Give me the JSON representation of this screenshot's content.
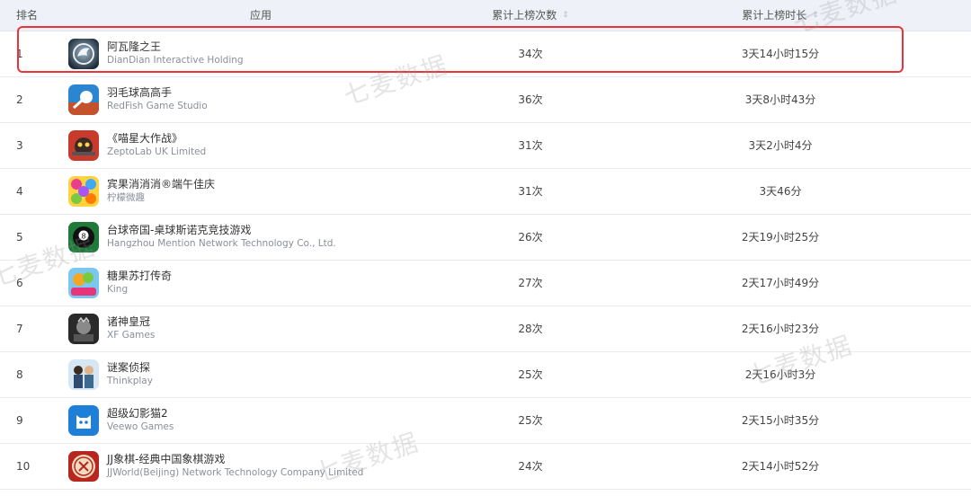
{
  "header": {
    "rank": "排名",
    "app": "应用",
    "count": "累计上榜次数",
    "duration": "累计上榜时长"
  },
  "sort_glyph": "⇕",
  "watermark": "七麦数据",
  "highlight_color": "#e8343a",
  "rows": [
    {
      "rank": "1",
      "name": "阿瓦隆之王",
      "developer": "DianDian Interactive Holding",
      "count": "34次",
      "duration": "3天14小时15分",
      "icon": "avalon-dragon-icon"
    },
    {
      "rank": "2",
      "name": "羽毛球高高手",
      "developer": "RedFish Game Studio",
      "count": "36次",
      "duration": "3天8小时43分",
      "icon": "badminton-icon"
    },
    {
      "rank": "3",
      "name": "《喵星大作战》",
      "developer": "ZeptoLab UK Limited",
      "count": "31次",
      "duration": "3天2小时4分",
      "icon": "cat-battle-icon"
    },
    {
      "rank": "4",
      "name": "宾果消消消®端午佳庆",
      "developer": "柠檬微趣",
      "count": "31次",
      "duration": "3天46分",
      "icon": "bingo-candy-icon"
    },
    {
      "rank": "5",
      "name": "台球帝国-桌球斯诺克竞技游戏",
      "developer": "Hangzhou Mention Network Technology Co., Ltd.",
      "count": "26次",
      "duration": "2天19小时25分",
      "icon": "billiard-ball-icon"
    },
    {
      "rank": "6",
      "name": "糖果苏打传奇",
      "developer": "King",
      "count": "27次",
      "duration": "2天17小时49分",
      "icon": "candy-soda-icon"
    },
    {
      "rank": "7",
      "name": "诸神皇冠",
      "developer": "XF Games",
      "count": "28次",
      "duration": "2天16小时23分",
      "icon": "gods-crown-icon"
    },
    {
      "rank": "8",
      "name": "谜案侦探",
      "developer": "Thinkplay",
      "count": "25次",
      "duration": "2天16小时3分",
      "icon": "detective-icon"
    },
    {
      "rank": "9",
      "name": "超级幻影猫2",
      "developer": "Veewo Games",
      "count": "25次",
      "duration": "2天15小时35分",
      "icon": "phantom-cat-icon"
    },
    {
      "rank": "10",
      "name": "JJ象棋-经典中国象棋游戏",
      "developer": "JJWorld(Beijing) Network Technology Company Limited",
      "count": "24次",
      "duration": "2天14小时52分",
      "icon": "chinese-chess-icon"
    }
  ]
}
